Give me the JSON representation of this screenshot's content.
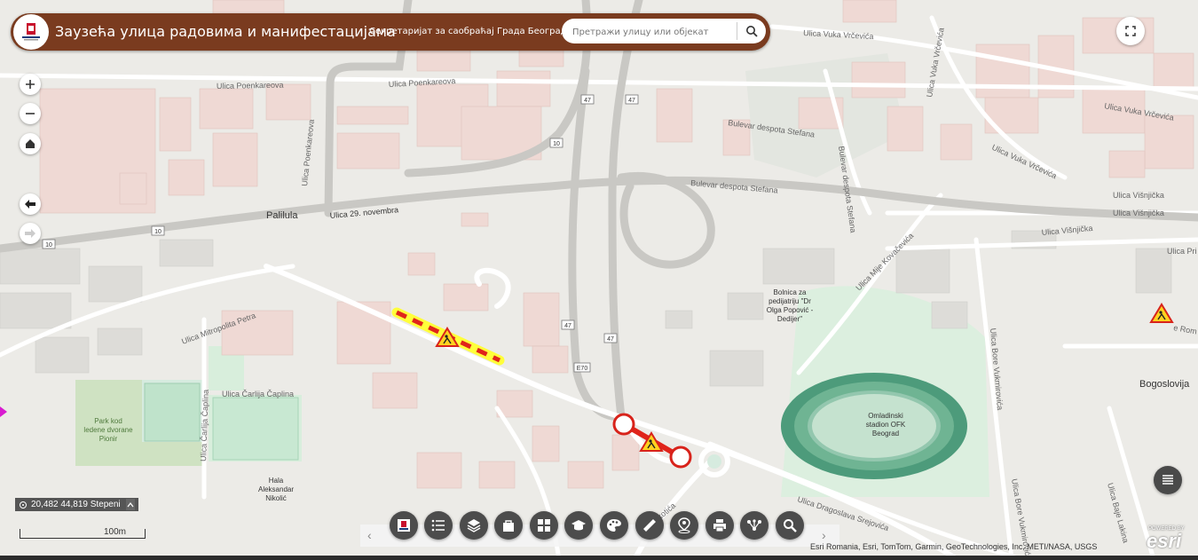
{
  "header": {
    "title": "Заузећа улица радовима и манифестацијама",
    "subtitle": "Секретаријат за саобраћај Града Београда",
    "search_placeholder": "Претражи улицу или објекат"
  },
  "map": {
    "streets": {
      "poenkareova_1": "Ulica Poenkareova",
      "poenkareova_2": "Ulica Poenkareova",
      "poenkareova_v": "Ulica Poenkareova",
      "nov29": "Ulica 29. novembra",
      "despota1": "Bulevar despota Stefana",
      "despota2": "Bulevar despota Stefana",
      "despota3": "Bulevar despota Stefana",
      "vrcevica1": "Ulica Vuka Vrčevića",
      "vrcevica2": "Ulica Vuka Vrčevića",
      "vrcevica3": "Ulica Vuka Vrčevića",
      "vrcevica_v": "Ulica Vuka Vrčevića",
      "visnjicka1": "Ulica Višnjička",
      "visnjicka2": "Ulica Višnjička",
      "visnjicka3": "Ulica Višnjička",
      "mitropolita": "Ulica Mitropolita Petra",
      "caplina1": "Ulica Čarlija Čaplina",
      "caplina2": "Ulica Čarlija Čaplina",
      "kovacevica": "Ulica Mije Kovačevića",
      "vukmirovica1": "Ulica Bore Vukmirovića",
      "vukmirovica2": "Ulica Bore Vukmirovića",
      "dragoslava": "Ulica Dragoslava Srejovića",
      "lakina": "Ulica Baje Lakina",
      "pri": "Ulica Pri",
      "roma": "e Rom",
      "tick": "ukotića"
    },
    "places": {
      "palilula": "Palilula",
      "bogoslovija": "Bogoslovija",
      "bolnica": [
        "Bolnica za",
        "pedijatriju \"Dr",
        "Olga Popović -",
        "Dedijer\""
      ],
      "stadion": [
        "Omladinski",
        "stadion OFK",
        "Beograd"
      ],
      "park": [
        "Park kod",
        "ledene dvorane",
        "Pionir"
      ],
      "hala": [
        "Hala",
        "Aleksandar",
        "Nikolić"
      ]
    },
    "road_shields": [
      "10",
      "10",
      "10",
      "47",
      "47",
      "47",
      "47",
      "E70"
    ]
  },
  "coordinates": "20,482 44,819 Stepeni",
  "scale_label": "100m",
  "attribution": "Esri Romania, Esri, TomTom, Garmin, GeoTechnologies, Inc, METI/NASA, USGS",
  "esri": {
    "powered": "POWERED BY",
    "name": "esri"
  },
  "colors": {
    "header": "#7a3b1f",
    "tool": "#4c4c4c",
    "closure": "#e0241b",
    "closure_halo": "#ffff00"
  },
  "toolbar_icons": [
    "logo-icon",
    "list-icon",
    "layers-icon",
    "bag-icon",
    "grid-icon",
    "mortarboard-icon",
    "palette-icon",
    "ruler-icon",
    "location-icon",
    "print-icon",
    "share-icon",
    "search-icon"
  ]
}
